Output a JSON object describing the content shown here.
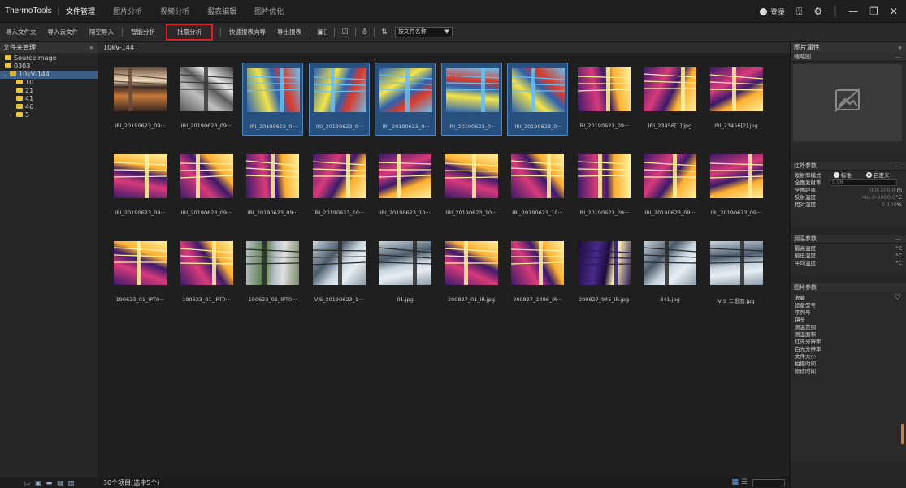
{
  "app": {
    "name": "ThermoTools",
    "menus": [
      {
        "label": "文件管理"
      },
      {
        "label": "图片分析"
      },
      {
        "label": "视频分析"
      },
      {
        "label": "报表编辑"
      },
      {
        "label": "图片优化"
      }
    ],
    "login": "登录"
  },
  "toolbar": {
    "import_folder": "导入文件夹",
    "import_cloud": "导入云文件",
    "batch_import": "隔空导入",
    "smart_analysis": "智能分析",
    "batch_analysis": "批量分析",
    "quick_report": "快速报表向导",
    "export_report": "导出报表",
    "sort_value": "按文件名称"
  },
  "left": {
    "title": "文件夹管理",
    "tree": [
      {
        "label": "SourceImage",
        "level": 1,
        "selected": false,
        "expanded": false
      },
      {
        "label": "0303",
        "level": 1,
        "selected": false,
        "expanded": false
      },
      {
        "label": "10kV-144",
        "level": 1,
        "selected": true,
        "expanded": true
      },
      {
        "label": "10",
        "level": 2,
        "selected": false,
        "expanded": false
      },
      {
        "label": "21",
        "level": 2,
        "selected": false,
        "expanded": false
      },
      {
        "label": "41",
        "level": 2,
        "selected": false,
        "expanded": false
      },
      {
        "label": "46",
        "level": 2,
        "selected": false,
        "expanded": false
      },
      {
        "label": "5",
        "level": 2,
        "selected": false,
        "expanded": false
      }
    ]
  },
  "main": {
    "path": "10kV-144",
    "status": "30个项目(选中5个)",
    "thumbs": [
      {
        "caption": "IRI_20190623_09···",
        "selected": false,
        "palette": "grey-warm"
      },
      {
        "caption": "IRI_20190623_09···",
        "selected": false,
        "palette": "grey"
      },
      {
        "caption": "IRI_20190623_0···",
        "selected": true,
        "palette": "blue"
      },
      {
        "caption": "IRI_20190623_0···",
        "selected": true,
        "palette": "blue"
      },
      {
        "caption": "IRI_20190623_0···",
        "selected": true,
        "palette": "blue"
      },
      {
        "caption": "IRI_20190623_0···",
        "selected": true,
        "palette": "blue"
      },
      {
        "caption": "IRI_20190623_0···",
        "selected": true,
        "palette": "blue"
      },
      {
        "caption": "IRI_20190623_09···",
        "selected": false,
        "palette": "iron"
      },
      {
        "caption": "IRI_23456[1].jpg",
        "selected": false,
        "palette": "iron"
      },
      {
        "caption": "IRI_23456[2].jpg",
        "selected": false,
        "palette": "iron"
      },
      {
        "caption": "IRI_20190623_09···",
        "selected": false,
        "palette": "iron"
      },
      {
        "caption": "IRI_20190623_09···",
        "selected": false,
        "palette": "iron"
      },
      {
        "caption": "IRI_20190623_09···",
        "selected": false,
        "palette": "iron"
      },
      {
        "caption": "IRI_20190623_10···",
        "selected": false,
        "palette": "iron"
      },
      {
        "caption": "IRI_20190623_10···",
        "selected": false,
        "palette": "iron"
      },
      {
        "caption": "IRI_20190623_10···",
        "selected": false,
        "palette": "iron"
      },
      {
        "caption": "IRI_20190623_10···",
        "selected": false,
        "palette": "iron"
      },
      {
        "caption": "IRI_20190623_09···",
        "selected": false,
        "palette": "iron"
      },
      {
        "caption": "IRI_20190623_09···",
        "selected": false,
        "palette": "iron"
      },
      {
        "caption": "IRI_20190623_09···",
        "selected": false,
        "palette": "iron"
      },
      {
        "caption": "190623_01_IPT0···",
        "selected": false,
        "palette": "iron"
      },
      {
        "caption": "190623_01_IPT0···",
        "selected": false,
        "palette": "iron"
      },
      {
        "caption": "190623_01_IPT0···",
        "selected": false,
        "palette": "photo-green"
      },
      {
        "caption": "VIS_20190623_1···",
        "selected": false,
        "palette": "photo-sky"
      },
      {
        "caption": "01.jpg",
        "selected": false,
        "palette": "photo-sky"
      },
      {
        "caption": "200827_01_IR.jpg",
        "selected": false,
        "palette": "iron"
      },
      {
        "caption": "200827_2486_IR···",
        "selected": false,
        "palette": "iron"
      },
      {
        "caption": "200827_945_IR.jpg",
        "selected": false,
        "palette": "iron-dark"
      },
      {
        "caption": "341.jpg",
        "selected": false,
        "palette": "photo-sky"
      },
      {
        "caption": "VIS_二悉而.jpg",
        "selected": false,
        "palette": "photo-sky"
      }
    ]
  },
  "right": {
    "title": "图片属性",
    "thumbnail_title": "缩略图",
    "ir_params_title": "红外参数",
    "emis_mode_label": "发射率模式",
    "emis_standard": "标准",
    "emis_custom": "自定义",
    "global_emis_label": "全图发射率",
    "global_emis_value": "0.98",
    "global_distance_label": "全图距离",
    "global_distance_value": "0.0-100.0",
    "global_distance_unit": "m",
    "reflect_temp_label": "反射温度",
    "reflect_temp_value": "-40.0-2000.0",
    "reflect_temp_unit": "°C",
    "humidity_label": "相对湿度",
    "humidity_value": "0-100",
    "humidity_unit": "%",
    "temp_params_title": "测温参数",
    "max_temp": "最高温度",
    "min_temp": "最低温度",
    "avg_temp": "平均温度",
    "temp_unit": "°C",
    "image_params_title": "图片参数",
    "image_params": [
      "收藏",
      "设备型号",
      "序列号",
      "镜头",
      "测温范围",
      "测温面积",
      "红外分辨率",
      "白光分辨率",
      "文件大小",
      "拍摄时间",
      "修改时间"
    ]
  },
  "colors": {
    "selection": "#27507e",
    "highlight_box": "#e02020",
    "tree_selected": "#3c5f8a"
  }
}
